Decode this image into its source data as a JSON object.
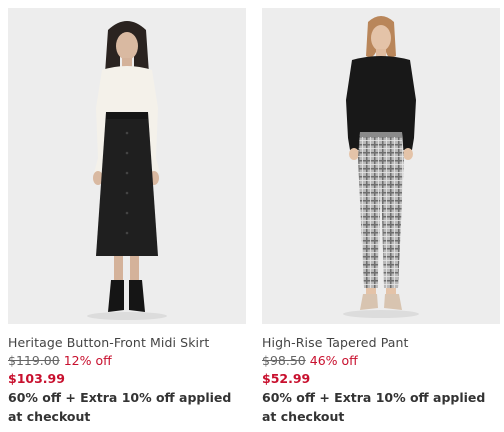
{
  "colors": {
    "sale": "#c8102e",
    "text": "#333333",
    "photo_bg": "#eeeeee"
  },
  "products": [
    {
      "name": "Heritage Button-Front Midi Skirt",
      "original_price": "$119.00",
      "discount": "12% off",
      "sale_price": "$103.99",
      "promo": "60% off + Extra 10% off applied at checkout"
    },
    {
      "name": "High-Rise Tapered Pant",
      "original_price": "$98.50",
      "discount": "46% off",
      "sale_price": "$52.99",
      "promo": "60% off + Extra 10% off applied at checkout"
    }
  ]
}
